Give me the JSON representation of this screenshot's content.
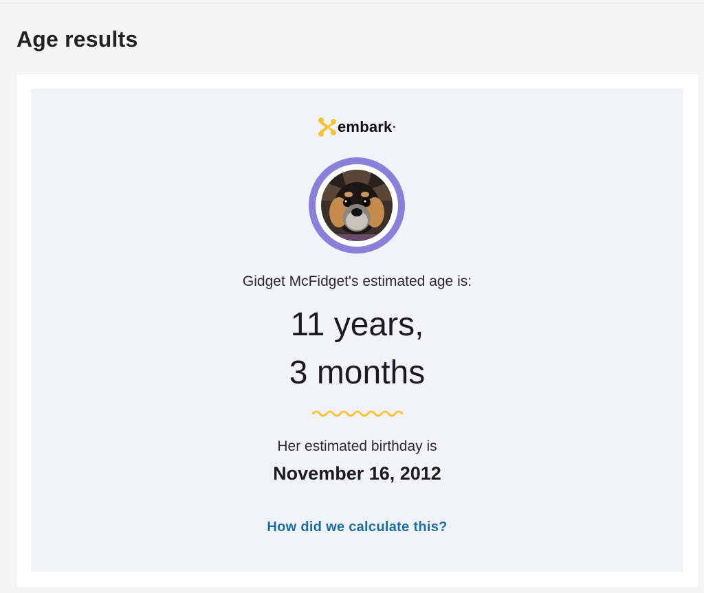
{
  "page": {
    "title": "Age results"
  },
  "brand": {
    "logo_text": "embark",
    "logo_icon": "embark-logo-icon",
    "accent_color": "#f6c338",
    "ring_color": "#8b80d9",
    "link_color": "#1c6f9c"
  },
  "result": {
    "intro": "Gidget McFidget's estimated age is:",
    "age_years": "11 years,",
    "age_months": "3 months",
    "birthday_intro": "Her estimated birthday is",
    "birthday": "November 16, 2012",
    "calc_link": "How did we calculate this?"
  }
}
